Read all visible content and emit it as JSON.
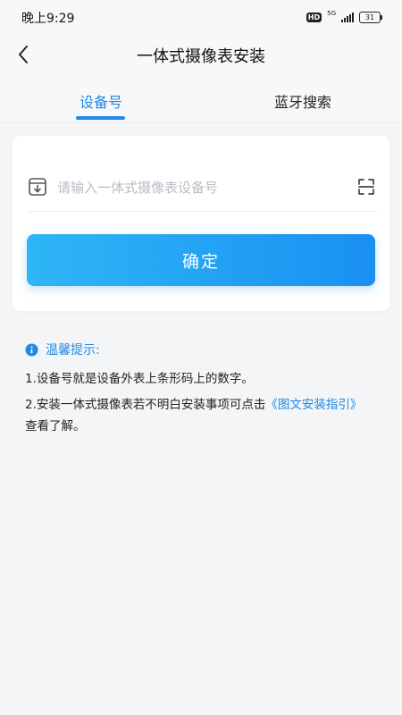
{
  "status_bar": {
    "time": "晚上9:29",
    "hd": "HD",
    "network": "5G",
    "battery": "31"
  },
  "nav": {
    "title": "一体式摄像表安装"
  },
  "tabs": {
    "active": "设备号",
    "inactive": "蓝牙搜索"
  },
  "form": {
    "placeholder": "请输入一体式摄像表设备号",
    "value": "",
    "confirm_label": "确定"
  },
  "tips": {
    "title": "温馨提示:",
    "line1": "1.设备号就是设备外表上条形码上的数字。",
    "line2_prefix": "2.安装一体式摄像表若不明白安装事项可点击",
    "line2_link": "《图文安装指引》",
    "line2_suffix": "查看了解。"
  },
  "colors": {
    "accent": "#1f8be6",
    "button_start": "#2fb6f6",
    "button_end": "#1a90f2",
    "background": "#f4f5f7"
  },
  "icons": {
    "back": "chevron-left-icon",
    "input": "download-box-icon",
    "scan": "scan-icon",
    "info": "info-icon"
  }
}
